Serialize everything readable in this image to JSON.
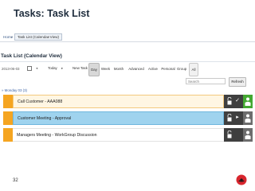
{
  "slide": {
    "title": "Tasks: Task List",
    "page_number": "32"
  },
  "breadcrumb": {
    "home": "Home",
    "separator": "»",
    "current_tab": "Task List (Calendar View)",
    "close_glyph": "x"
  },
  "view": {
    "title": "Task List (Calendar View)"
  },
  "toolbar": {
    "date_value": "2013-06-03",
    "prev_glyph": "◂",
    "today_label": "Today",
    "next_glyph": "▸",
    "new_task_label": "New Task",
    "view_buttons": [
      "Day",
      "Week",
      "Month",
      "Advanced",
      "Active",
      "Personal",
      "Group",
      "All"
    ],
    "selected_view": "Day",
    "search_placeholder": "Search",
    "refresh_label": "Refresh"
  },
  "group": {
    "header": "» Monday 03 (3)"
  },
  "tasks": [
    {
      "label": "Call Customer - AAA088",
      "action_icon": "check-icon",
      "owner_box_color": "#44a832"
    },
    {
      "label": "Customer Meeting - Approval",
      "action_icon": "play-icon",
      "owner_box_color": "#6d6d6d"
    },
    {
      "label": "Managers Meeting - WorkGroup Discussion",
      "action_icon": "none",
      "owner_box_color": "#6d6d6d"
    }
  ],
  "colors": {
    "stripe_orange": "#f5a521",
    "row1_fill": "#fff6e3",
    "row2_fill": "#9fd3ee",
    "controls_dark": "#3f3f3f",
    "owner_green": "#44a832",
    "logo_red": "#d8262e"
  }
}
